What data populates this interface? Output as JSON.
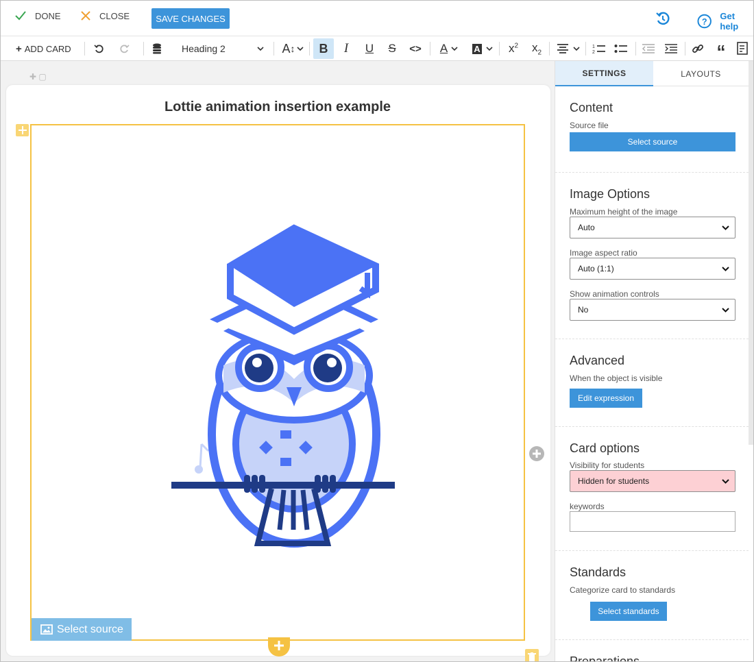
{
  "topbar": {
    "done_label": "DONE",
    "close_label": "CLOSE",
    "save_label": "SAVE CHANGES",
    "help_label": "Get help"
  },
  "toolbar": {
    "add_card_label": "ADD CARD",
    "heading_value": "Heading 2"
  },
  "card": {
    "title": "Lottie animation insertion example",
    "select_source_overlay": "Select source"
  },
  "settings": {
    "tabs": [
      "SETTINGS",
      "LAYOUTS"
    ],
    "content": {
      "title": "Content",
      "source_label": "Source file",
      "source_button": "Select source"
    },
    "image_options": {
      "title": "Image Options",
      "max_height_label": "Maximum height of the image",
      "max_height_value": "Auto",
      "aspect_label": "Image aspect ratio",
      "aspect_value": "Auto (1:1)",
      "controls_label": "Show animation controls",
      "controls_value": "No"
    },
    "advanced": {
      "title": "Advanced",
      "visible_label": "When the object is visible",
      "edit_button": "Edit expression"
    },
    "card_options": {
      "title": "Card options",
      "visibility_label": "Visibility for students",
      "visibility_value": "Hidden for students",
      "keywords_label": "keywords",
      "keywords_value": ""
    },
    "standards": {
      "title": "Standards",
      "categorize_label": "Categorize card to standards",
      "select_button": "Select standards"
    },
    "preparations": {
      "title": "Preparations"
    }
  },
  "colors": {
    "accent": "#3d94da",
    "selection_border": "#f5c243",
    "owl_blue": "#4b72f5",
    "owl_light": "#c6d3f9",
    "owl_dark": "#1f3b86",
    "hidden_select_bg": "#fdd0d4"
  },
  "icons": [
    "check-icon",
    "close-icon",
    "history-icon",
    "help-icon",
    "plus-icon",
    "undo-icon",
    "redo-icon",
    "database-icon",
    "font-size-icon",
    "bold-icon",
    "italic-icon",
    "underline-icon",
    "strikethrough-icon",
    "code-icon",
    "text-color-icon",
    "highlight-icon",
    "superscript-icon",
    "subscript-icon",
    "align-icon",
    "ordered-list-icon",
    "bullet-list-icon",
    "outdent-icon",
    "indent-icon",
    "link-icon",
    "quote-icon",
    "source-icon",
    "image-icon",
    "trash-icon"
  ]
}
